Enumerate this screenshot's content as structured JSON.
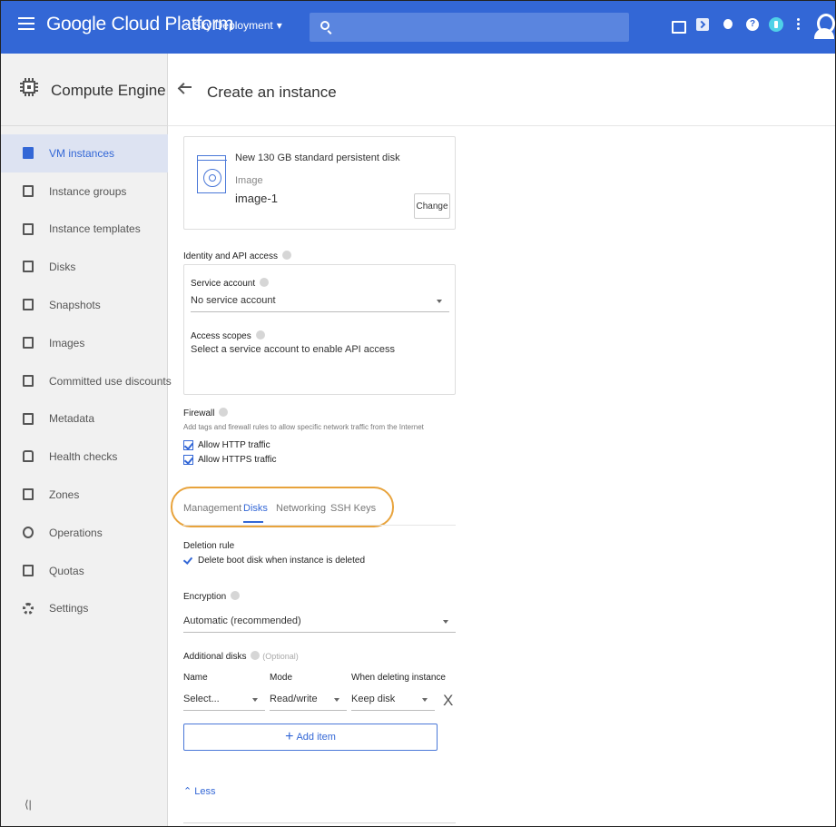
{
  "topbar": {
    "brand": "Google Cloud Platform",
    "project": "Sky Deployment",
    "project_icon": "project-dots-icon",
    "search_icon": "search-icon",
    "icons": [
      "gift-icon",
      "cloud-shell-icon",
      "alert-icon",
      "help-icon",
      "notifications-icon",
      "more-vert-icon",
      "account-icon"
    ],
    "color": "#3367d6"
  },
  "sidebar": {
    "title": "Compute Engine",
    "items": [
      {
        "label": "VM instances",
        "icon": "vm-instances-icon",
        "active": true
      },
      {
        "label": "Instance groups",
        "icon": "instance-groups-icon"
      },
      {
        "label": "Instance templates",
        "icon": "instance-templates-icon"
      },
      {
        "label": "Disks",
        "icon": "disks-icon"
      },
      {
        "label": "Snapshots",
        "icon": "snapshots-icon"
      },
      {
        "label": "Images",
        "icon": "images-icon"
      },
      {
        "label": "Committed use discounts",
        "icon": "percent-icon"
      },
      {
        "label": "Metadata",
        "icon": "metadata-icon"
      },
      {
        "label": "Health checks",
        "icon": "health-checks-icon"
      },
      {
        "label": "Zones",
        "icon": "zones-icon"
      },
      {
        "label": "Operations",
        "icon": "clock-icon"
      },
      {
        "label": "Quotas",
        "icon": "quotas-icon"
      },
      {
        "label": "Settings",
        "icon": "gear-icon"
      }
    ],
    "collapse_label": "⟨|"
  },
  "page": {
    "title": "Create an instance"
  },
  "boot_disk": {
    "name": "New 130 GB standard persistent disk",
    "image_label": "Image",
    "image_value": "image-1",
    "change_label": "Change"
  },
  "identity": {
    "title": "Identity and API access",
    "service_account_label": "Service account",
    "service_account_value": "No service account",
    "access_scopes_label": "Access scopes",
    "access_scopes_text": "Select a service account to enable API access"
  },
  "firewall": {
    "title": "Firewall",
    "description": "Add tags and firewall rules to allow specific network traffic from the Internet",
    "http_label": "Allow HTTP traffic",
    "https_label": "Allow HTTPS traffic"
  },
  "tabs": {
    "management": "Management",
    "disks": "Disks",
    "networking": "Networking",
    "ssh_keys": "SSH Keys",
    "active": "Disks",
    "highlight_color": "#e8a33c"
  },
  "disks_tab": {
    "deletion_rule_title": "Deletion rule",
    "delete_boot_label": "Delete boot disk when instance is deleted",
    "encryption_title": "Encryption",
    "encryption_value": "Automatic (recommended)",
    "additional_title": "Additional disks",
    "optional_label": "(Optional)",
    "col_name": "Name",
    "col_mode": "Mode",
    "col_when": "When deleting instance",
    "name_value": "Select...",
    "mode_value": "Read/write",
    "when_value": "Keep disk",
    "remove_label": "X",
    "add_item_label": "Add item",
    "less_label": "Less"
  }
}
